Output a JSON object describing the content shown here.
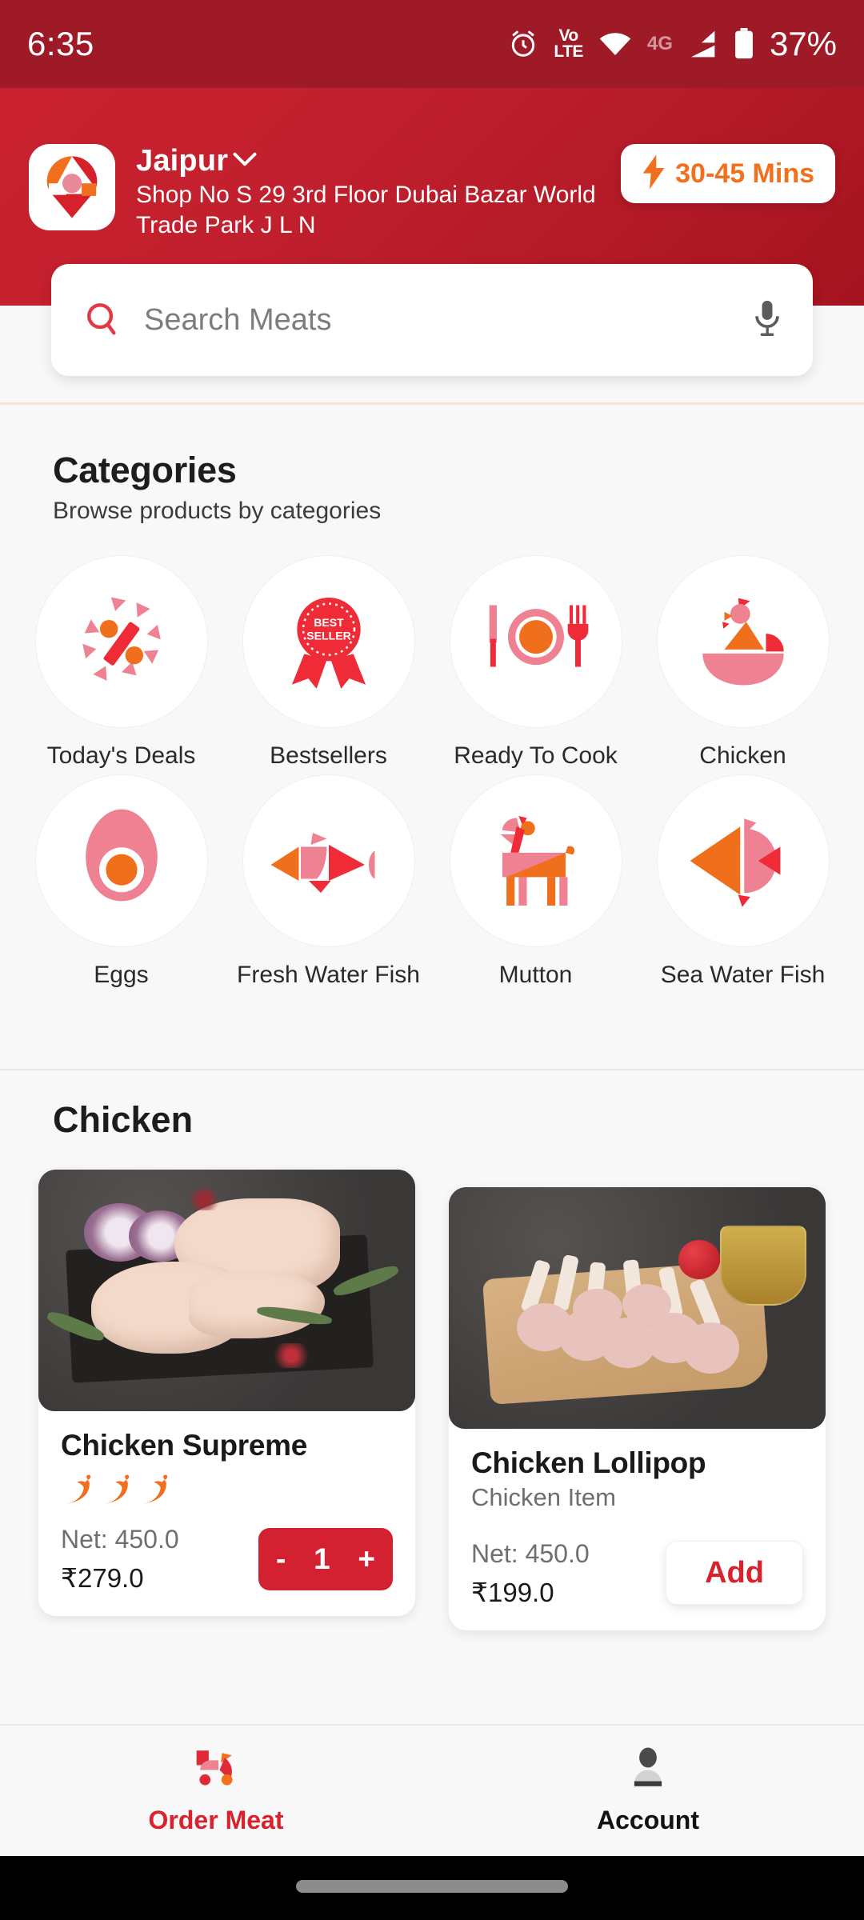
{
  "status_bar": {
    "time": "6:35",
    "battery_percent": "37%",
    "network_label": "4G",
    "volte_top": "Vo",
    "volte_bottom": "LTE",
    "icons": [
      "alarm-icon",
      "volte-icon",
      "wifi-icon",
      "signal-icon",
      "battery-icon"
    ]
  },
  "header": {
    "logo_icon": "map-pin-logo-icon",
    "city": "Jaipur",
    "city_chevron_icon": "chevron-down-icon",
    "address": "Shop No S 29 3rd Floor Dubai Bazar World Trade Park J L N",
    "eta_badge": {
      "icon": "lightning-bolt-icon",
      "label": "30-45 Mins"
    },
    "bg_color": "#c2202e"
  },
  "search": {
    "icon": "search-icon",
    "placeholder": "Search Meats",
    "value": "",
    "mic_icon": "microphone-icon"
  },
  "categories": {
    "title": "Categories",
    "subtitle": "Browse products by categories",
    "items": [
      {
        "label": "Today's Deals",
        "icon": "percent-discount-icon"
      },
      {
        "label": "Bestsellers",
        "icon": "best-seller-badge-icon",
        "badge_top": "BEST",
        "badge_bottom": "SELLER"
      },
      {
        "label": "Ready To Cook",
        "icon": "plate-cutlery-icon"
      },
      {
        "label": "Chicken",
        "icon": "chicken-bowl-icon"
      },
      {
        "label": "Eggs",
        "icon": "egg-icon"
      },
      {
        "label": "Fresh Water Fish",
        "icon": "fish-icon"
      },
      {
        "label": "Mutton",
        "icon": "goat-icon"
      },
      {
        "label": "Sea Water Fish",
        "icon": "sea-fish-icon"
      }
    ]
  },
  "products": {
    "section_title": "Chicken",
    "items": [
      {
        "name": "Chicken Supreme",
        "subtitle": "",
        "spice_level": 3,
        "spice_icon": "chili-pepper-icon",
        "net": "Net: 450.0",
        "price": "₹279.0",
        "control": "stepper",
        "minus_label": "-",
        "quantity": "1",
        "plus_label": "+",
        "image_alt": "raw-chicken-legs-on-slate-board"
      },
      {
        "name": "Chicken Lollipop",
        "subtitle": "Chicken Item",
        "spice_level": 0,
        "net": "Net: 450.0",
        "price": "₹199.0",
        "control": "add",
        "add_label": "Add",
        "image_alt": "chicken-lollipops-on-wooden-board"
      }
    ]
  },
  "bottom_nav": {
    "items": [
      {
        "label": "Order Meat",
        "icon": "scooter-delivery-icon",
        "active": true
      },
      {
        "label": "Account",
        "icon": "person-account-icon",
        "active": false
      }
    ]
  },
  "colors": {
    "brand_red": "#c2202e",
    "status_bar_red": "#9e1a27",
    "accent_orange": "#f2701d",
    "accent_pink": "#e88a9a",
    "price_red": "#d8232e",
    "page_bg": "#f8f8f8"
  }
}
